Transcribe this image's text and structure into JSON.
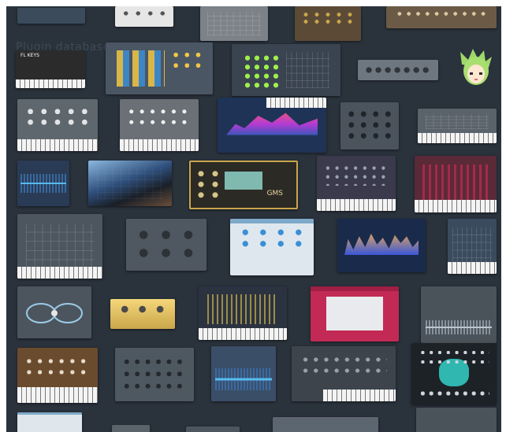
{
  "background_label": "Plugin database",
  "colors": {
    "backdrop": "#2a323c",
    "accent_gold": "#c9a64b",
    "accent_red": "#c22a55",
    "accent_blue": "#3a8fd6"
  },
  "plugins": [
    {
      "id": "p01",
      "style": "dark",
      "label": ""
    },
    {
      "id": "p02",
      "style": "white-knobs",
      "label": ""
    },
    {
      "id": "p03",
      "style": "grey",
      "label": ""
    },
    {
      "id": "p04",
      "style": "brown",
      "label": ""
    },
    {
      "id": "p05",
      "style": "brown-wide",
      "label": ""
    },
    {
      "id": "p06",
      "style": "fl-keys",
      "label": "FL KEYS"
    },
    {
      "id": "p07",
      "style": "sequencer",
      "label": ""
    },
    {
      "id": "p08",
      "style": "pad-drum",
      "label": ""
    },
    {
      "id": "p09",
      "style": "slim-knobs",
      "label": ""
    },
    {
      "id": "p10",
      "style": "grey-synth",
      "label": ""
    },
    {
      "id": "p11",
      "style": "grey-synth-2",
      "label": ""
    },
    {
      "id": "p12",
      "style": "spectrum",
      "label": ""
    },
    {
      "id": "p13",
      "style": "knob-grid",
      "label": ""
    },
    {
      "id": "p14",
      "style": "light-synth",
      "label": ""
    },
    {
      "id": "p15",
      "style": "wave-blue",
      "label": ""
    },
    {
      "id": "p16",
      "style": "photo-studio",
      "label": ""
    },
    {
      "id": "p17",
      "style": "gms",
      "label": "GMS"
    },
    {
      "id": "p18",
      "style": "purple-synth",
      "label": ""
    },
    {
      "id": "p19",
      "style": "red-synth",
      "label": ""
    },
    {
      "id": "p20",
      "style": "dark-seq",
      "label": ""
    },
    {
      "id": "p21",
      "style": "grey-knobs",
      "label": ""
    },
    {
      "id": "p22",
      "style": "light-eq",
      "label": ""
    },
    {
      "id": "p23",
      "style": "analyzer",
      "label": ""
    },
    {
      "id": "p24",
      "style": "dark-keys",
      "label": ""
    },
    {
      "id": "p25",
      "style": "routing",
      "label": ""
    },
    {
      "id": "p26",
      "style": "gold-fx",
      "label": ""
    },
    {
      "id": "p27",
      "style": "poly-synth",
      "label": ""
    },
    {
      "id": "p28",
      "style": "pink-synth",
      "label": ""
    },
    {
      "id": "p29",
      "style": "wave-dark",
      "label": ""
    },
    {
      "id": "p30",
      "style": "wood-synth",
      "label": ""
    },
    {
      "id": "p31",
      "style": "grey-rack",
      "label": ""
    },
    {
      "id": "p32",
      "style": "slicer",
      "label": ""
    },
    {
      "id": "p33",
      "style": "dark-synth",
      "label": ""
    },
    {
      "id": "p34",
      "style": "sytrus",
      "label": ""
    },
    {
      "id": "p35",
      "style": "bottom-light",
      "label": ""
    },
    {
      "id": "p36",
      "style": "bottom-grey",
      "label": ""
    },
    {
      "id": "p37",
      "style": "bottom-grey",
      "label": ""
    },
    {
      "id": "p38",
      "style": "bottom-grey",
      "label": ""
    }
  ]
}
